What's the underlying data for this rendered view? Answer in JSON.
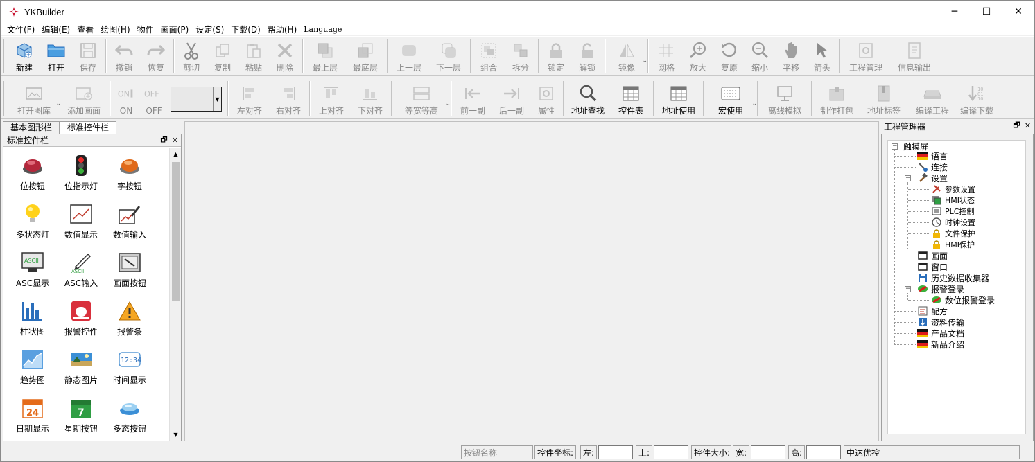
{
  "app": {
    "title": "YKBuilder"
  },
  "window_controls": {
    "minimize": "─",
    "maximize": "☐",
    "close": "✕"
  },
  "menu": [
    "文件(F)",
    "编辑(E)",
    "查看",
    "绘图(H)",
    "物件",
    "画面(P)",
    "设定(S)",
    "下载(D)",
    "帮助(H)",
    "Language"
  ],
  "toolbar1": [
    {
      "label": "新建",
      "icon": "new-icon",
      "enabled": true
    },
    {
      "label": "打开",
      "icon": "open-folder-icon",
      "enabled": true
    },
    {
      "label": "保存",
      "icon": "save-icon",
      "enabled": false
    },
    {
      "label": "撤销",
      "icon": "undo-icon",
      "enabled": false
    },
    {
      "label": "恢复",
      "icon": "redo-icon",
      "enabled": false
    },
    {
      "label": "剪切",
      "icon": "cut-icon",
      "enabled": false
    },
    {
      "label": "复制",
      "icon": "copy-icon",
      "enabled": false
    },
    {
      "label": "粘贴",
      "icon": "paste-icon",
      "enabled": false
    },
    {
      "label": "删除",
      "icon": "delete-icon",
      "enabled": false
    },
    {
      "label": "最上层",
      "icon": "bring-front-icon",
      "enabled": false
    },
    {
      "label": "最底层",
      "icon": "send-back-icon",
      "enabled": false
    },
    {
      "label": "上一层",
      "icon": "bring-forward-icon",
      "enabled": false
    },
    {
      "label": "下一层",
      "icon": "send-backward-icon",
      "enabled": false
    },
    {
      "label": "组合",
      "icon": "group-icon",
      "enabled": false
    },
    {
      "label": "拆分",
      "icon": "ungroup-icon",
      "enabled": false
    },
    {
      "label": "锁定",
      "icon": "lock-icon",
      "enabled": false
    },
    {
      "label": "解锁",
      "icon": "unlock-icon",
      "enabled": false
    },
    {
      "label": "镜像",
      "icon": "mirror-icon",
      "enabled": false
    },
    {
      "label": "网格",
      "icon": "grid-icon",
      "enabled": false
    },
    {
      "label": "放大",
      "icon": "zoom-in-icon",
      "enabled": false
    },
    {
      "label": "复原",
      "icon": "restore-icon",
      "enabled": false
    },
    {
      "label": "缩小",
      "icon": "zoom-out-icon",
      "enabled": false
    },
    {
      "label": "平移",
      "icon": "pan-hand-icon",
      "enabled": false
    },
    {
      "label": "箭头",
      "icon": "arrow-cursor-icon",
      "enabled": false
    },
    {
      "label": "工程管理",
      "icon": "project-manage-icon",
      "enabled": false
    },
    {
      "label": "信息输出",
      "icon": "info-output-icon",
      "enabled": false
    }
  ],
  "toolbar2": [
    {
      "label": "打开图库",
      "icon": "open-gallery-icon",
      "enabled": false
    },
    {
      "label": "添加画面",
      "icon": "add-screen-icon",
      "enabled": false
    },
    {
      "label": "ON",
      "icon": "on-icon",
      "enabled": false
    },
    {
      "label": "OFF",
      "icon": "off-icon",
      "enabled": false
    },
    {
      "label": "左对齐",
      "icon": "align-left-icon",
      "enabled": false
    },
    {
      "label": "右对齐",
      "icon": "align-right-icon",
      "enabled": false
    },
    {
      "label": "上对齐",
      "icon": "align-top-icon",
      "enabled": false
    },
    {
      "label": "下对齐",
      "icon": "align-bottom-icon",
      "enabled": false
    },
    {
      "label": "等宽等高",
      "icon": "equal-size-icon",
      "enabled": false
    },
    {
      "label": "前一副",
      "icon": "prev-screen-icon",
      "enabled": false
    },
    {
      "label": "后一副",
      "icon": "next-screen-icon",
      "enabled": false
    },
    {
      "label": "属性",
      "icon": "properties-icon",
      "enabled": false
    },
    {
      "label": "地址查找",
      "icon": "address-search-icon",
      "enabled": true
    },
    {
      "label": "控件表",
      "icon": "control-table-icon",
      "enabled": true
    },
    {
      "label": "地址使用",
      "icon": "address-use-icon",
      "enabled": true
    },
    {
      "label": "宏使用",
      "icon": "macro-use-icon",
      "enabled": true
    },
    {
      "label": "离线模拟",
      "icon": "offline-sim-icon",
      "enabled": false
    },
    {
      "label": "制作打包",
      "icon": "make-package-icon",
      "enabled": false
    },
    {
      "label": "地址标签",
      "icon": "address-tag-icon",
      "enabled": false
    },
    {
      "label": "编译工程",
      "icon": "compile-icon",
      "enabled": false
    },
    {
      "label": "编译下载",
      "icon": "compile-download-icon",
      "enabled": false
    }
  ],
  "left_tabs": [
    "基本图形栏",
    "标准控件栏"
  ],
  "left_panel_title": "标准控件栏",
  "widgets": [
    {
      "label": "位按钮",
      "icon": "bit-button-icon"
    },
    {
      "label": "位指示灯",
      "icon": "traffic-light-icon"
    },
    {
      "label": "字按钮",
      "icon": "word-button-icon"
    },
    {
      "label": "多状态灯",
      "icon": "bulb-icon"
    },
    {
      "label": "数值显示",
      "icon": "numeric-display-icon"
    },
    {
      "label": "数值输入",
      "icon": "numeric-input-icon"
    },
    {
      "label": "ASC显示",
      "icon": "ascii-display-icon"
    },
    {
      "label": "ASC输入",
      "icon": "ascii-input-icon"
    },
    {
      "label": "画面按钮",
      "icon": "screen-button-icon"
    },
    {
      "label": "柱状图",
      "icon": "bar-chart-icon"
    },
    {
      "label": "报警控件",
      "icon": "alarm-control-icon"
    },
    {
      "label": "报警条",
      "icon": "warning-bar-icon"
    },
    {
      "label": "趋势图",
      "icon": "trend-chart-icon"
    },
    {
      "label": "静态图片",
      "icon": "static-picture-icon"
    },
    {
      "label": "时间显示",
      "icon": "time-display-icon"
    },
    {
      "label": "日期显示",
      "icon": "calendar-icon"
    },
    {
      "label": "星期按钮",
      "icon": "week-calendar-icon"
    },
    {
      "label": "多态按钮",
      "icon": "multistate-button-icon"
    }
  ],
  "widget_icon_text": {
    "ascii": "ASCII",
    "time": "12:34",
    "date": "24",
    "week": "7"
  },
  "right_panel_title": "工程管理器",
  "tree": {
    "root": "触摸屏",
    "language": "语言",
    "connect": "连接",
    "settings": "设置",
    "param": "参数设置",
    "hmi_status": "HMI状态",
    "plc": "PLC控制",
    "clock": "时钟设置",
    "file_protect": "文件保护",
    "hmi_protect": "HMI保护",
    "screen": "画面",
    "window": "窗口",
    "history": "历史数据收集器",
    "alarm_login": "报警登录",
    "digital_alarm": "数位报警登录",
    "recipe": "配方",
    "data_transfer": "资料传输",
    "product_doc": "产品文档",
    "new_product": "新品介绍"
  },
  "status": {
    "button_name_placeholder": "按钮名称",
    "coord_label": "控件坐标:",
    "left_label": "左:",
    "top_label": "上:",
    "size_label": "控件大小:",
    "width_label": "宽:",
    "height_label": "高:",
    "vendor": "中达优控"
  },
  "colors": {
    "accent_blue": "#2a6ebb",
    "brand_red": "#c8102e"
  }
}
